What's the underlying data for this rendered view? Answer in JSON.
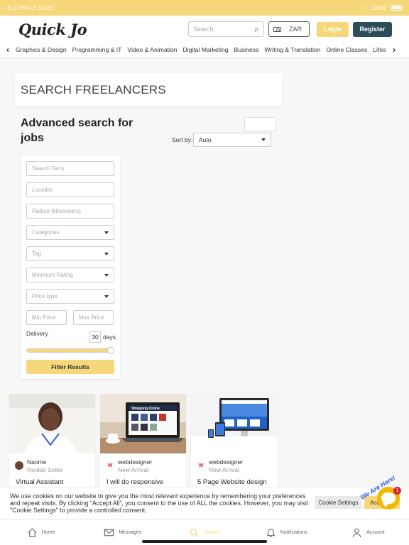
{
  "status": {
    "time": "8:11 PM",
    "date": "Fri Jul 23",
    "battery": "100%"
  },
  "header": {
    "logo": "Quick Jo",
    "search_placeholder": "Search",
    "currency": "ZAR",
    "login_label": "Login",
    "register_label": "Register"
  },
  "categories": [
    "Graphics & Design",
    "Programming & IT",
    "Video & Animation",
    "Digital Marketing",
    "Business",
    "Writing & Translation",
    "Online Classes",
    "Lifestyle"
  ],
  "page_title": "SEARCH FREELANCERS",
  "advanced": {
    "title": "Advanced search for jobs",
    "sort_label": "Sort by:",
    "sort_value": "Auto"
  },
  "filters": {
    "search_term": "Search Term",
    "location": "Location",
    "radius": "Radius (kilometers)",
    "categories": "Categories",
    "tag": "Tag",
    "minimum_rating": "Minimum Rating",
    "price_type": "Price type",
    "min_price": "Min Price",
    "max_price": "Max Price",
    "delivery_label": "Delivery",
    "delivery_days": "30",
    "days_label": "days",
    "delivery_fraction": 1.0,
    "filter_button": "Filter Results"
  },
  "cards": [
    {
      "seller": "Naome",
      "level": "Rookie Seller",
      "title": "Virtual Assistant"
    },
    {
      "seller": "webdesigner",
      "level": "New Arrival",
      "title": "I will do responsive",
      "screen_text": "Shopping Online"
    },
    {
      "seller": "webdesigner",
      "level": "New Arrival",
      "title": "5 Page Website design"
    }
  ],
  "cookie": {
    "text": "We use cookies on our website to give you the most relevant experience by remembering your preferences and repeat visits. By clicking “Accept All”, you consent to the use of ALL the cookies. However, you may visit \"Cookie Settings\" to provide a controlled consent.",
    "settings_label": "Cookie Settings",
    "accept_label": "Accept All"
  },
  "chat": {
    "sign": "We Are Here!",
    "badge": "1"
  },
  "tabs": [
    "Home",
    "Messages",
    "Search",
    "Notifications",
    "Account"
  ],
  "colors": {
    "accent": "#f6d87a",
    "brand_dark": "#2b4e5a",
    "chat": "#f2b705"
  }
}
